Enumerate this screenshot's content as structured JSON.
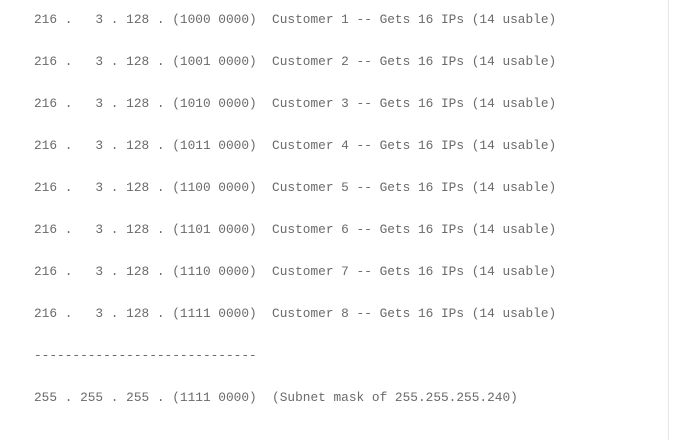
{
  "lines": [
    "216 .   3 . 128 . (1000 0000)  Customer 1 -- Gets 16 IPs (14 usable)",
    "216 .   3 . 128 . (1001 0000)  Customer 2 -- Gets 16 IPs (14 usable)",
    "216 .   3 . 128 . (1010 0000)  Customer 3 -- Gets 16 IPs (14 usable)",
    "216 .   3 . 128 . (1011 0000)  Customer 4 -- Gets 16 IPs (14 usable)",
    "216 .   3 . 128 . (1100 0000)  Customer 5 -- Gets 16 IPs (14 usable)",
    "216 .   3 . 128 . (1101 0000)  Customer 6 -- Gets 16 IPs (14 usable)",
    "216 .   3 . 128 . (1110 0000)  Customer 7 -- Gets 16 IPs (14 usable)",
    "216 .   3 . 128 . (1111 0000)  Customer 8 -- Gets 16 IPs (14 usable)"
  ],
  "separator": "-----------------------------",
  "mask_line": "255 . 255 . 255 . (1111 0000)  (Subnet mask of 255.255.255.240)"
}
